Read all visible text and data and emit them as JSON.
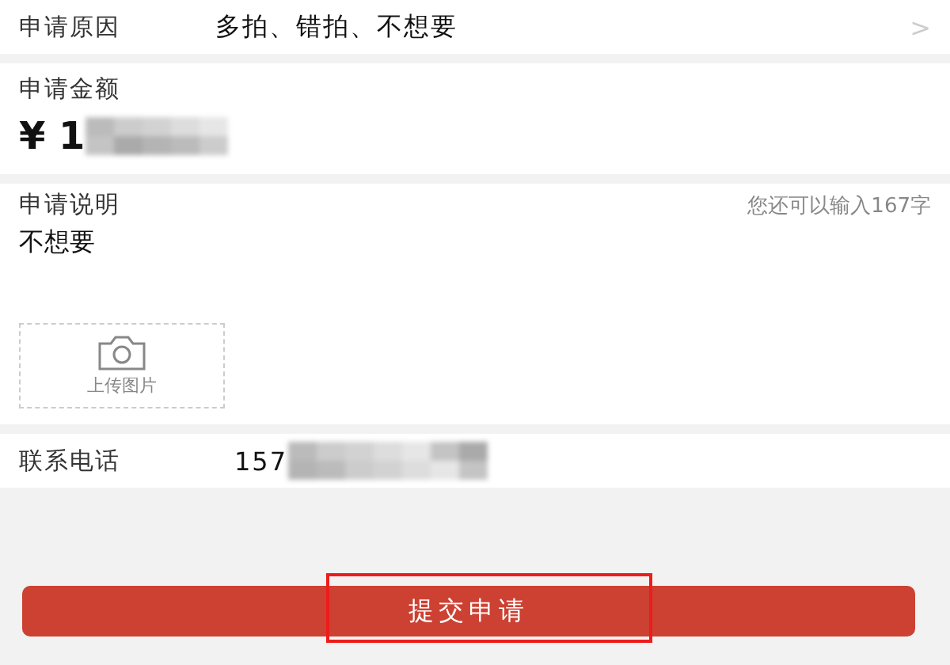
{
  "reason": {
    "label": "申请原因",
    "value": "多拍、错拍、不想要",
    "chevron": ">"
  },
  "amount": {
    "label": "申请金额",
    "value": "¥ 1"
  },
  "description": {
    "label": "申请说明",
    "counter": "您还可以输入167字",
    "value": "不想要",
    "upload": {
      "label": "上传图片"
    }
  },
  "phone": {
    "label": "联系电话",
    "value": "157"
  },
  "submit": {
    "label": "提交申请",
    "highlighted": true
  }
}
